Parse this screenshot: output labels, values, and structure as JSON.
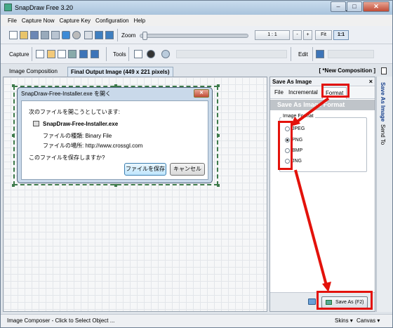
{
  "window": {
    "title": "SnapDraw Free 3.20"
  },
  "menu": [
    "File",
    "Capture Now",
    "Capture Key",
    "Configuration",
    "Help"
  ],
  "toolbar": {
    "zoom_label": "Zoom",
    "zoom_value": "1 : 1",
    "zoom_minus": "-",
    "zoom_plus": "+",
    "fit_label": "Fit",
    "one_to_one": "1:1",
    "capture_label": "Capture",
    "tools_label": "Tools",
    "edit_label": "Edit"
  },
  "tabs": {
    "composition": "Image Composition",
    "output": "Final Output Image (449 x 221 pixels)",
    "new_composition": "[ *New Composition ]"
  },
  "dialog": {
    "title": "SnapDraw-Free-Installer.exe を開く",
    "prompt": "次のファイルを開こうとしています:",
    "filename": "SnapDraw-Free-Installer.exe",
    "type_line": "ファイルの種類:  Binary File",
    "location_line": "ファイルの場所:  http://www.crossgl.com",
    "question": "このファイルを保存しますか?",
    "save_button": "ファイルを保存",
    "cancel_button": "キャンセル"
  },
  "save_panel": {
    "header": "Save As Image",
    "close": "×",
    "tabs": [
      "File",
      "Incremental",
      "Format"
    ],
    "section_title": "Save As Image Format",
    "group_label": "Image Format",
    "formats": [
      {
        "label": "JPEG",
        "selected": false
      },
      {
        "label": "PNG",
        "selected": true
      },
      {
        "label": "BMP",
        "selected": false
      },
      {
        "label": "JNG",
        "selected": false
      }
    ],
    "save_button": "Save As (F2)"
  },
  "side_tabs": [
    "Save As Image",
    "Send To"
  ],
  "status": {
    "text": "Image Composer - Click to Select Object ...",
    "skins": "Skins",
    "canvas": "Canvas"
  },
  "colors": {
    "highlight": "#e3120b",
    "selection": "#3c7a4a"
  }
}
